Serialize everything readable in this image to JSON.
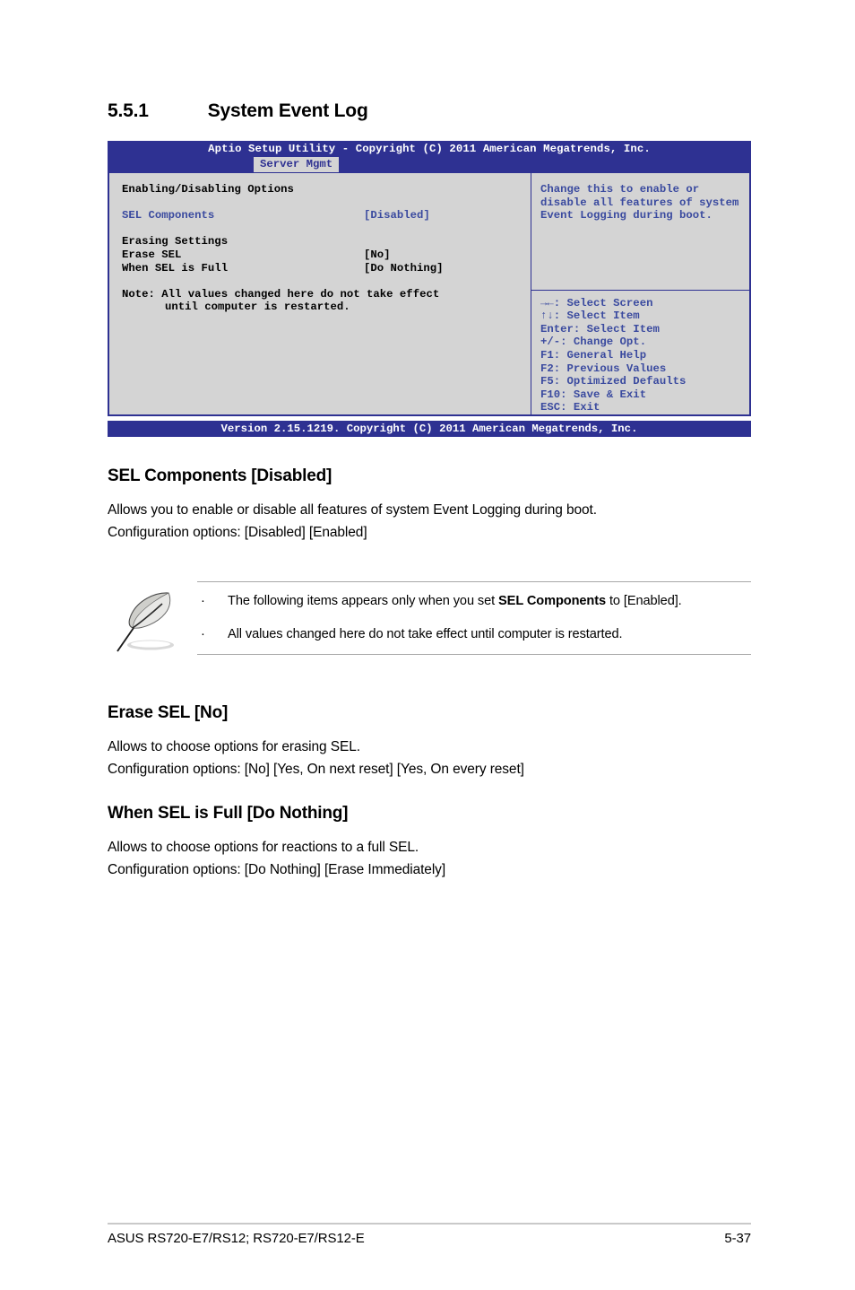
{
  "heading": {
    "number": "5.5.1",
    "title": "System Event Log"
  },
  "bios": {
    "title_bar": "Aptio Setup Utility - Copyright (C) 2011 American Megatrends, Inc.",
    "active_tab": "Server Mgmt",
    "left_panel": {
      "group1_title": "Enabling/Disabling Options",
      "item1_label": "SEL Components",
      "item1_value": "[Disabled]",
      "group2_title": "Erasing Settings",
      "item2_label": "Erase SEL",
      "item2_value": "[No]",
      "item3_label": "When SEL is Full",
      "item3_value": "[Do Nothing]",
      "note_line1": "Note: All values changed here do not take effect",
      "note_line2": "until computer is restarted."
    },
    "help_panel": {
      "text": "Change this to enable or disable all features of system Event Logging during boot."
    },
    "keys": [
      "→←: Select Screen",
      "↑↓:  Select Item",
      "Enter: Select Item",
      "+/-: Change Opt.",
      "F1: General Help",
      "F2: Previous Values",
      "F5: Optimized Defaults",
      "F10: Save & Exit",
      "ESC: Exit"
    ],
    "footer_bar": "Version 2.15.1219. Copyright (C) 2011 American Megatrends, Inc.",
    "colors": {
      "bar_blue": "#2e3192",
      "body_gray": "#d4d4d4",
      "text_blue": "#3a4a9f"
    }
  },
  "sections": [
    {
      "heading": "SEL Components [Disabled]",
      "line1": "Allows you to enable or disable all features of system Event Logging during boot.",
      "line2": "Configuration options: [Disabled] [Enabled]"
    },
    {
      "heading": "Erase SEL [No]",
      "line1": "Allows to choose options for erasing SEL.",
      "line2": "Configuration options: [No] [Yes, On next reset] [Yes, On every reset]"
    },
    {
      "heading": "When SEL is Full [Do Nothing]",
      "line1": "Allows to choose options for reactions to a full SEL.",
      "line2": "Configuration options: [Do Nothing] [Erase Immediately]"
    }
  ],
  "note": {
    "icon": "quill-pen-icon",
    "bullet": "·",
    "item1_pre": "The following items appears only when you set ",
    "item1_bold": "SEL Components",
    "item1_post": " to [Enabled].",
    "item2": "All values changed here do not take effect until computer is restarted."
  },
  "footer": {
    "left": "ASUS RS720-E7/RS12; RS720-E7/RS12-E",
    "page": "5-37"
  }
}
